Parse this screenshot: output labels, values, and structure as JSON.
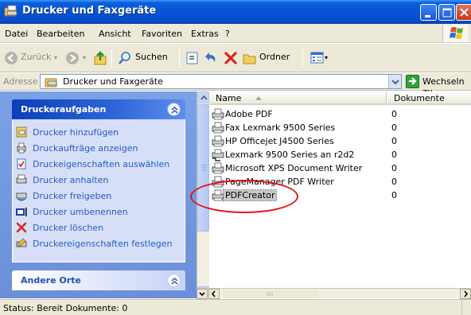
{
  "window": {
    "title": "Drucker und Faxgeräte",
    "accent": "#0654d5",
    "close_color": "#c4381a"
  },
  "menu": [
    "Datei",
    "Bearbeiten",
    "Ansicht",
    "Favoriten",
    "Extras",
    "?"
  ],
  "toolbar": {
    "back_label": "Zurück",
    "search_label": "Suchen",
    "folders_label": "Ordner"
  },
  "address": {
    "label": "Adresse",
    "value": "Drucker und Faxgeräte",
    "go_label": "Wechseln zu"
  },
  "taskpane": {
    "printer_tasks": {
      "title": "Druckeraufgaben",
      "items": [
        {
          "label": "Drucker hinzufügen",
          "icon": "add-printer-icon"
        },
        {
          "label": "Druckaufträge anzeigen",
          "icon": "print-queue-icon"
        },
        {
          "label": "Druckeigenschaften auswählen",
          "icon": "print-preferences-icon"
        },
        {
          "label": "Drucker anhalten",
          "icon": "pause-printer-icon"
        },
        {
          "label": "Drucker freigeben",
          "icon": "share-printer-icon"
        },
        {
          "label": "Drucker umbenennen",
          "icon": "rename-icon"
        },
        {
          "label": "Drucker löschen",
          "icon": "delete-icon"
        },
        {
          "label": "Druckereigenschaften festlegen",
          "icon": "printer-properties-icon"
        }
      ]
    },
    "other_places": {
      "title": "Andere Orte"
    }
  },
  "list": {
    "columns": [
      "Name",
      "Dokumente"
    ],
    "rows": [
      {
        "name": "Adobe PDF",
        "count": "0"
      },
      {
        "name": "Fax Lexmark 9500 Series",
        "count": "0"
      },
      {
        "name": "HP Officejet J4500 Series",
        "count": "0"
      },
      {
        "name": "Lexmark 9500 Series an r2d2",
        "count": "0"
      },
      {
        "name": "Microsoft XPS Document Writer",
        "count": "0"
      },
      {
        "name": "PageManager PDF Writer",
        "count": "0"
      },
      {
        "name": "PDFCreator",
        "count": "0",
        "selected": true
      }
    ],
    "highlight_color": "#e0141c"
  },
  "status": {
    "text": "Status: Bereit Dokumente: 0"
  }
}
